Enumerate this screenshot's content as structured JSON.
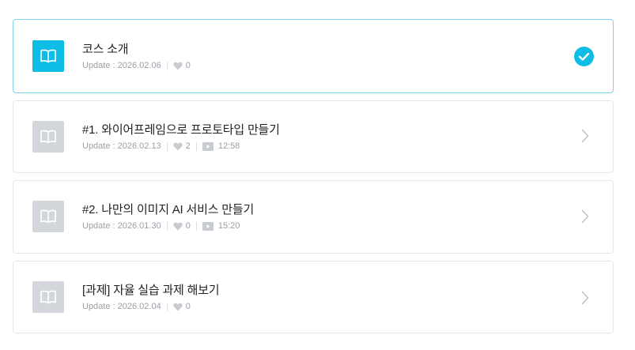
{
  "items": [
    {
      "title": "코스 소개",
      "update": "Update : 2026.02.06",
      "likes": "0",
      "duration": "",
      "completed": true
    },
    {
      "title": "#1. 와이어프레임으로 프로토타입 만들기",
      "update": "Update : 2026.02.13",
      "likes": "2",
      "duration": "12:58",
      "completed": false
    },
    {
      "title": "#2. 나만의 이미지 AI 서비스 만들기",
      "update": "Update : 2026.01.30",
      "likes": "0",
      "duration": "15:20",
      "completed": false
    },
    {
      "title": "[과제] 자율 실습 과제 해보기",
      "update": "Update : 2026.02.04",
      "likes": "0",
      "duration": "",
      "completed": false
    }
  ],
  "icons": {
    "thumb": "open-book-icon",
    "likes": "heart-icon",
    "duration": "video-play-icon",
    "completed": "check-circle-icon",
    "open": "chevron-right-icon"
  },
  "colors": {
    "accent": "#0ebde6",
    "active_border": "#7fd6ea",
    "thumb_inactive": "#d3d7dc",
    "meta_text": "#9aa0a6"
  }
}
